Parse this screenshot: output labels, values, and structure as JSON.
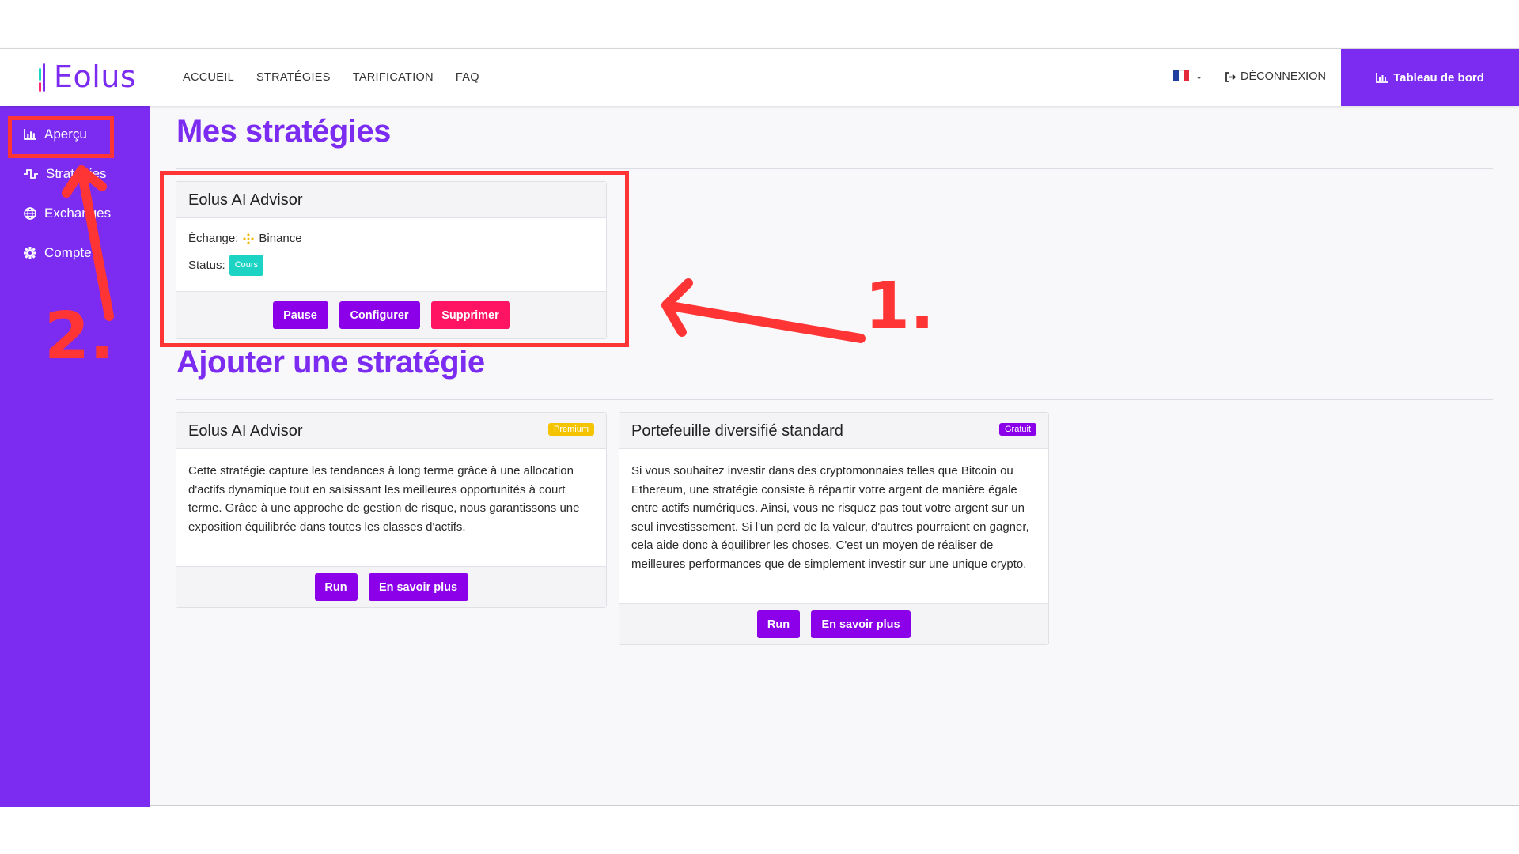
{
  "brand": {
    "name": "Eolus"
  },
  "nav": {
    "items": [
      "ACCUEIL",
      "STRATÉGIES",
      "TARIFICATION",
      "FAQ"
    ],
    "logout": "DÉCONNEXION",
    "dashboard": "Tableau de bord"
  },
  "sidebar": {
    "items": [
      {
        "label": "Aperçu",
        "icon": "bar-chart-icon"
      },
      {
        "label": "Stratégies",
        "icon": "pulse-icon"
      },
      {
        "label": "Exchanges",
        "icon": "globe-icon"
      },
      {
        "label": "Compte",
        "icon": "gear-icon"
      }
    ]
  },
  "my_strategies": {
    "heading": "Mes stratégies",
    "card": {
      "title": "Eolus AI Advisor",
      "exchange_label": "Échange:",
      "exchange_value": "Binance",
      "status_label": "Status:",
      "status_value": "Cours",
      "buttons": {
        "pause": "Pause",
        "configure": "Configurer",
        "delete": "Supprimer"
      }
    }
  },
  "add_strategy": {
    "heading": "Ajouter une stratégie",
    "cards": [
      {
        "title": "Eolus AI Advisor",
        "badge": "Premium",
        "description": "Cette stratégie capture les tendances à long terme grâce à une allocation d'actifs dynamique tout en saisissant les meilleures opportunités à court terme. Grâce à une approche de gestion de risque, nous garantissons une exposition équilibrée dans toutes les classes d'actifs.",
        "run": "Run",
        "learn_more": "En savoir plus"
      },
      {
        "title": "Portefeuille diversifié standard",
        "badge": "Gratuit",
        "description": "Si vous souhaitez investir dans des cryptomonnaies telles que Bitcoin ou Ethereum, une stratégie consiste à répartir votre argent de manière égale entre actifs numériques. Ainsi, vous ne risquez pas tout votre argent sur un seul investissement. Si l'un perd de la valeur, d'autres pourraient en gagner, cela aide donc à équilibrer les choses. C'est un moyen de réaliser de meilleures performances que de simplement investir sur une unique crypto.",
        "run": "Run",
        "learn_more": "En savoir plus"
      }
    ]
  },
  "annotations": {
    "step1": "1.",
    "step2": "2."
  },
  "colors": {
    "primary": "#7b2cf0",
    "button": "#8b00e8",
    "danger": "#ff1464",
    "status": "#1dd3c4",
    "premium": "#f5c400",
    "annotation": "#ff3535"
  }
}
